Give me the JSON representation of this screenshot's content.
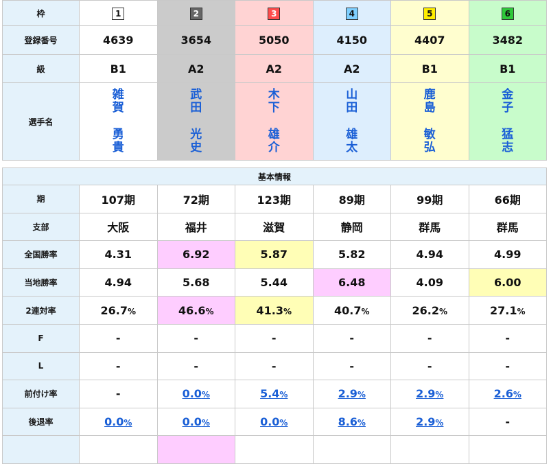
{
  "labels": {
    "waku": "枠",
    "reg_no": "登録番号",
    "class": "級",
    "name": "選手名",
    "section": "基本情報",
    "term": "期",
    "branch": "支部",
    "national_rate": "全国勝率",
    "local_rate": "当地勝率",
    "two_rate": "2連対率",
    "f": "F",
    "l": "L",
    "mae": "前付け率",
    "ato": "後退率"
  },
  "racers": [
    {
      "waku": "1",
      "reg": "4639",
      "class": "B1",
      "name1": [
        "雑",
        "賀"
      ],
      "name2": [
        "勇",
        "貴"
      ],
      "term": "107期",
      "branch": "大阪",
      "national": "4.31",
      "local": "4.94",
      "two_rate": "26.7",
      "f": "-",
      "l": "-",
      "mae": "-",
      "ato": "0.0"
    },
    {
      "waku": "2",
      "reg": "3654",
      "class": "A2",
      "name1": [
        "武",
        "田"
      ],
      "name2": [
        "光",
        "史"
      ],
      "term": "72期",
      "branch": "福井",
      "national": "6.92",
      "local": "5.68",
      "two_rate": "46.6",
      "f": "-",
      "l": "-",
      "mae": "0.0",
      "ato": "0.0"
    },
    {
      "waku": "3",
      "reg": "5050",
      "class": "A2",
      "name1": [
        "木",
        "下"
      ],
      "name2": [
        "雄",
        "介"
      ],
      "term": "123期",
      "branch": "滋賀",
      "national": "5.87",
      "local": "5.44",
      "two_rate": "41.3",
      "f": "-",
      "l": "-",
      "mae": "5.4",
      "ato": "0.0"
    },
    {
      "waku": "4",
      "reg": "4150",
      "class": "A2",
      "name1": [
        "山",
        "田"
      ],
      "name2": [
        "雄",
        "太"
      ],
      "term": "89期",
      "branch": "静岡",
      "national": "5.82",
      "local": "6.48",
      "two_rate": "40.7",
      "f": "-",
      "l": "-",
      "mae": "2.9",
      "ato": "8.6"
    },
    {
      "waku": "5",
      "reg": "4407",
      "class": "B1",
      "name1": [
        "鹿",
        "島"
      ],
      "name2": [
        "敏",
        "弘"
      ],
      "term": "99期",
      "branch": "群馬",
      "national": "4.94",
      "local": "4.09",
      "two_rate": "26.2",
      "f": "-",
      "l": "-",
      "mae": "2.9",
      "ato": "2.9"
    },
    {
      "waku": "6",
      "reg": "3482",
      "class": "B1",
      "name1": [
        "金",
        "子"
      ],
      "name2": [
        "猛",
        "志"
      ],
      "term": "66期",
      "branch": "群馬",
      "national": "4.99",
      "local": "6.00",
      "two_rate": "27.1",
      "f": "-",
      "l": "-",
      "mae": "2.6",
      "ato": "-"
    }
  ],
  "pct_unit": "%",
  "colors": {
    "label_bg": "#e4f2fb",
    "link": "#1a5fd6",
    "highlight_first": "#fecdff",
    "highlight_second": "#fffeb6"
  }
}
